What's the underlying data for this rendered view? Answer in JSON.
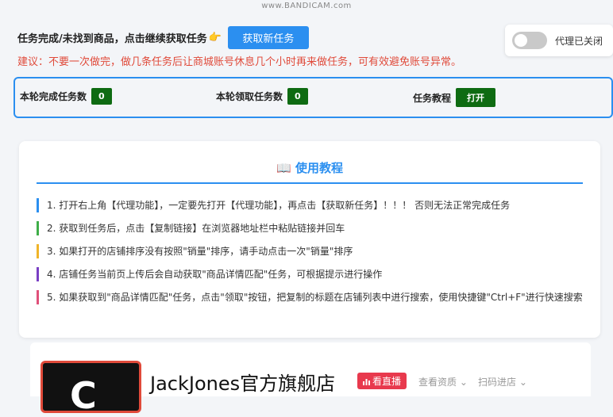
{
  "watermark": "www.BANDICAM.com",
  "header": {
    "message": "任务完成/未找到商品，点击继续获取任务",
    "emoji": "👉",
    "get_task_label": "获取新任务"
  },
  "proxy": {
    "label": "代理已关闭",
    "enabled": false
  },
  "advice": "建议：不要一次做完，做几条任务后让商城账号休息几个小时再来做任务，可有效避免账号异常。",
  "stats": {
    "completed_label": "本轮完成任务数",
    "completed_value": "0",
    "received_label": "本轮领取任务数",
    "received_value": "0",
    "tutorial_label": "任务教程",
    "open_label": "打开"
  },
  "tutorial": {
    "icon": "📖",
    "title": "使用教程",
    "steps": [
      {
        "text": "1. 打开右上角【代理功能】，一定要先打开【代理功能】，再点击【获取新任务】！！！ 否则无法正常完成任务",
        "color": "#2b8ff0"
      },
      {
        "text": "2. 获取到任务后，点击【复制链接】在浏览器地址栏中粘贴链接并回车",
        "color": "#3fae49"
      },
      {
        "text": "3. 如果打开的店铺排序没有按照\"销量\"排序，请手动点击一次\"销量\"排序",
        "color": "#f0b429"
      },
      {
        "text": "4. 店铺任务当前页上传后会自动获取\"商品详情匹配\"任务，可根据提示进行操作",
        "color": "#7a3fc4"
      },
      {
        "text": "5. 如果获取到\"商品详情匹配\"任务，点击\"领取\"按钮，把复制的标题在店铺列表中进行搜索，使用快捷键\"Ctrl+F\"进行快速搜索",
        "color": "#e0507a"
      }
    ]
  },
  "shop": {
    "name": "JackJones官方旗舰店",
    "live_label": "看直播",
    "live_icon": "bar-chart-icon",
    "view_label": "查看资质",
    "scan_label": "扫码进店"
  }
}
